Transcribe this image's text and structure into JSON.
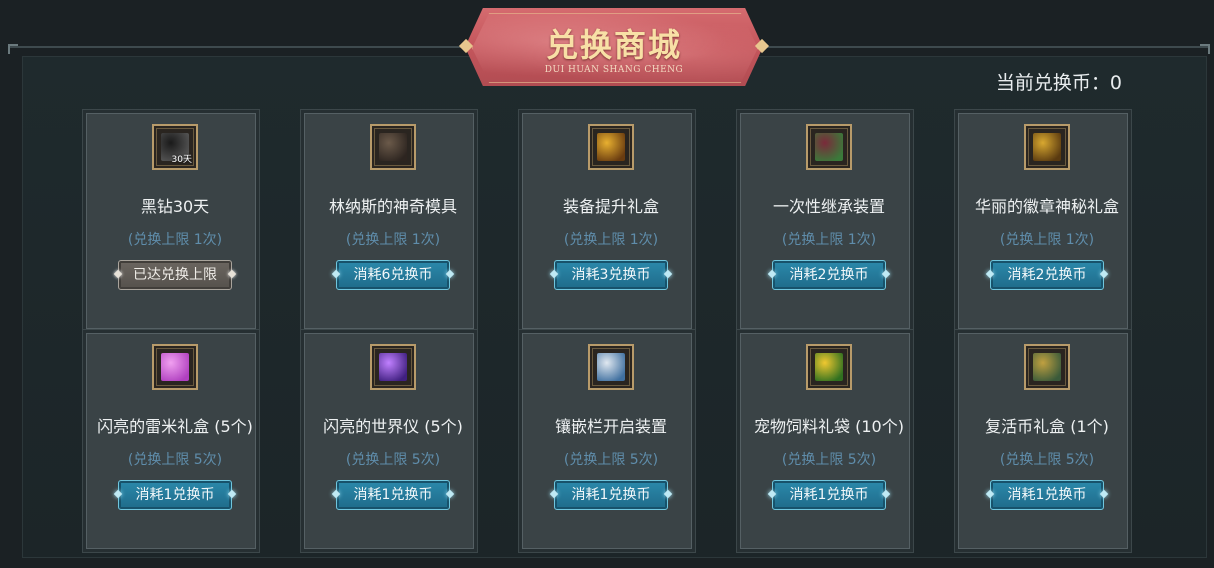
{
  "header": {
    "title": "兑换商城",
    "subtitle": "DUI HUAN SHANG CHENG",
    "coins_label": "当前兑换币：0"
  },
  "items": [
    {
      "name": "黑钻30天",
      "limit": "(兑换上限 1次)",
      "button": "已达兑换上限",
      "disabled": true,
      "icon": "black-diamond-icon",
      "icon_tag": "30天",
      "icon_colors": [
        "#1a1a1a",
        "#555555"
      ]
    },
    {
      "name": "林纳斯的神奇模具",
      "limit": "(兑换上限 1次)",
      "button": "消耗6兑换币",
      "disabled": false,
      "icon": "mold-icon",
      "icon_colors": [
        "#6b5a4a",
        "#2d2520"
      ]
    },
    {
      "name": "装备提升礼盒",
      "limit": "(兑换上限 1次)",
      "button": "消耗3兑换币",
      "disabled": false,
      "icon": "gift-box-icon",
      "icon_colors": [
        "#e8b030",
        "#6a3c10"
      ]
    },
    {
      "name": "一次性继承装置",
      "limit": "(兑换上限 1次)",
      "button": "消耗2兑换币",
      "disabled": false,
      "icon": "inherit-device-icon",
      "icon_colors": [
        "#7a2a3a",
        "#3a7a3a"
      ]
    },
    {
      "name": "华丽的徽章神秘礼盒",
      "limit": "(兑换上限 1次)",
      "button": "消耗2兑换币",
      "disabled": false,
      "icon": "emblem-box-icon",
      "icon_colors": [
        "#d8a830",
        "#5a3a10"
      ]
    },
    {
      "name": "闪亮的雷米礼盒 (5个)",
      "limit": "(兑换上限 5次)",
      "button": "消耗1兑换币",
      "disabled": false,
      "icon": "remy-box-icon",
      "icon_colors": [
        "#f0a0f0",
        "#b040c0"
      ]
    },
    {
      "name": "闪亮的世界仪 (5个)",
      "limit": "(兑换上限 5次)",
      "button": "消耗1兑换币",
      "disabled": false,
      "icon": "globe-icon",
      "icon_colors": [
        "#c080ff",
        "#402080"
      ]
    },
    {
      "name": "镶嵌栏开启装置",
      "limit": "(兑换上限 5次)",
      "button": "消耗1兑换币",
      "disabled": false,
      "icon": "socket-icon",
      "icon_colors": [
        "#e0e8f0",
        "#4070a0"
      ]
    },
    {
      "name": "宠物饲料礼袋 (10个)",
      "limit": "(兑换上限 5次)",
      "button": "消耗1兑换币",
      "disabled": false,
      "icon": "pet-food-icon",
      "icon_colors": [
        "#f0c830",
        "#307020"
      ]
    },
    {
      "name": "复活币礼盒 (1个)",
      "limit": "(兑换上限 5次)",
      "button": "消耗1兑换币",
      "disabled": false,
      "icon": "revive-coin-icon",
      "icon_colors": [
        "#c0a040",
        "#3a5a3a"
      ]
    }
  ]
}
